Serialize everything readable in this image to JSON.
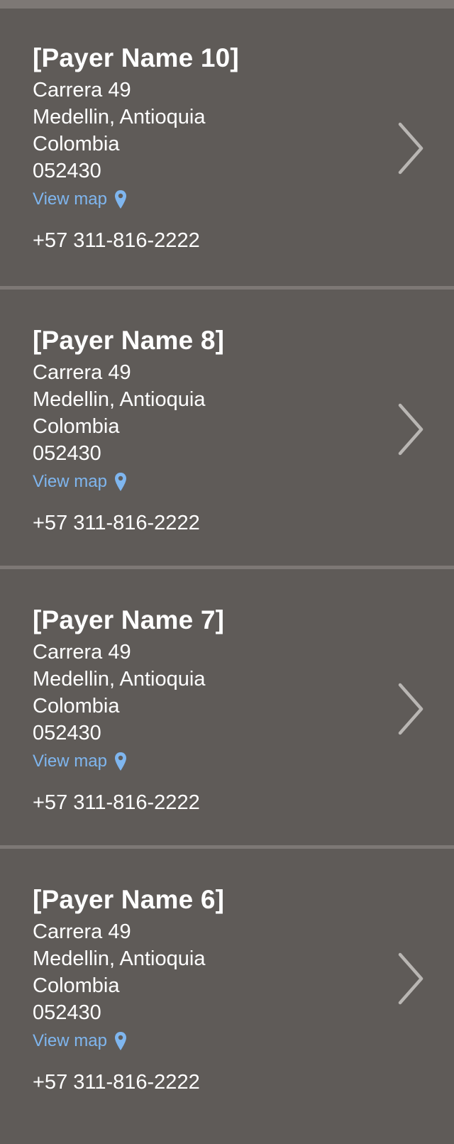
{
  "payers": [
    {
      "name": "[Payer Name 10]",
      "address": [
        "Carrera 49",
        "Medellin, Antioquia",
        "Colombia",
        "052430"
      ],
      "view_map_label": "View map",
      "phone": "+57 311-816-2222"
    },
    {
      "name": "[Payer Name 8]",
      "address": [
        "Carrera 49",
        "Medellin, Antioquia",
        "Colombia",
        "052430"
      ],
      "view_map_label": "View map",
      "phone": "+57 311-816-2222"
    },
    {
      "name": "[Payer Name 7]",
      "address": [
        "Carrera 49",
        "Medellin, Antioquia",
        "Colombia",
        "052430"
      ],
      "view_map_label": "View map",
      "phone": "+57 311-816-2222"
    },
    {
      "name": "[Payer Name 6]",
      "address": [
        "Carrera 49",
        "Medellin, Antioquia",
        "Colombia",
        "052430"
      ],
      "view_map_label": "View map",
      "phone": "+57 311-816-2222"
    }
  ],
  "icons": {
    "map": "map-pin-icon",
    "navigate": "chevron-right-icon"
  },
  "colors": {
    "background": "#5f5b58",
    "divider": "#7d7875",
    "link": "#7fb6ef",
    "chevron": "#b9b6b3"
  }
}
